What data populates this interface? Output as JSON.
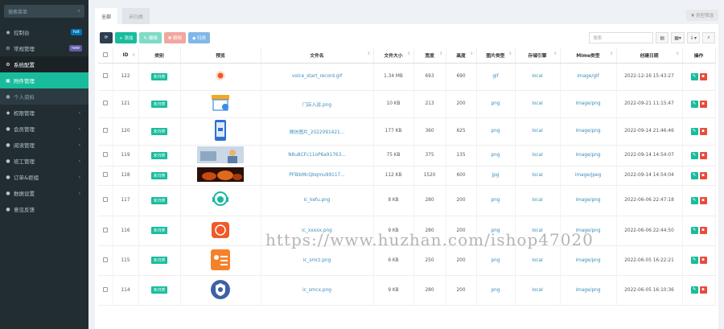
{
  "sidebar": {
    "search_placeholder": "搜索菜单",
    "items": [
      {
        "icon": "dashboard-icon",
        "glyph": "◉",
        "label": "控制台",
        "badge": "hot",
        "badge_color": "#0073b7"
      },
      {
        "icon": "cogs-icon",
        "glyph": "⚙",
        "label": "常规管理",
        "badge": "new",
        "badge_color": "#605ca8"
      },
      {
        "icon": "cog-icon",
        "glyph": "⚙",
        "label": "系统配置",
        "state": "sub"
      },
      {
        "icon": "file-image-icon",
        "glyph": "▣",
        "label": "附件管理",
        "state": "active"
      },
      {
        "icon": "user-icon",
        "glyph": "●",
        "label": "个人资料",
        "state": "dim"
      },
      {
        "icon": "group-icon",
        "glyph": "◆",
        "label": "权限管理",
        "chevron": true
      },
      {
        "icon": "users-icon",
        "glyph": "●",
        "label": "会员管理",
        "chevron": true
      },
      {
        "icon": "list-icon",
        "glyph": "●",
        "label": "阅读管理",
        "chevron": true
      },
      {
        "icon": "staff-icon",
        "glyph": "●",
        "label": "班工管理",
        "chevron": true
      },
      {
        "icon": "order-icon",
        "glyph": "●",
        "label": "订单&拒组",
        "chevron": true
      },
      {
        "icon": "data-icon",
        "glyph": "●",
        "label": "数据设置",
        "chevron": true
      },
      {
        "icon": "feedback-icon",
        "glyph": "●",
        "label": "意见反馈"
      }
    ]
  },
  "tabs": [
    {
      "label": "全部",
      "active": true
    },
    {
      "label": "未归类",
      "active": false
    }
  ],
  "filter_button": "▼ 类型筛选",
  "toolbar": {
    "refresh": "⟳",
    "add": "+ 添加",
    "edit": "✎ 编辑",
    "delete": "✖ 删除",
    "categorize": "◆ 归类"
  },
  "search": {
    "placeholder": "搜索"
  },
  "columns": [
    "",
    "ID",
    "类别",
    "预览",
    "文件名",
    "文件大小",
    "宽度",
    "高度",
    "图片类型",
    "存储引擎",
    "Mime类型",
    "创建日期",
    "操作"
  ],
  "rows": [
    {
      "id": "122",
      "category": "未归类",
      "thumb": "orange-dot",
      "filename": "voice_start_record.gif",
      "size": "1.34 MB",
      "width": "693",
      "height": "690",
      "type": "gif",
      "storage": "local",
      "mime": "image/gif",
      "date": "2022-12-16 15:43:27"
    },
    {
      "id": "121",
      "category": "未归类",
      "thumb": "shop",
      "filename": "门店入驻.png",
      "size": "10 KB",
      "width": "213",
      "height": "200",
      "type": "png",
      "storage": "local",
      "mime": "image/png",
      "date": "2022-09-21 11:15:47"
    },
    {
      "id": "120",
      "category": "未归类",
      "thumb": "phone",
      "filename": "微信图片_2022091421...",
      "size": "177 KB",
      "width": "360",
      "height": "625",
      "type": "png",
      "storage": "local",
      "mime": "image/png",
      "date": "2022-09-14 21:46:46"
    },
    {
      "id": "119",
      "category": "未归类",
      "thumb": "banner",
      "filename": "N8u8CFc11oP6a91763...",
      "size": "75 KB",
      "width": "375",
      "height": "135",
      "type": "png",
      "storage": "local",
      "mime": "image/png",
      "date": "2022-09-14 14:54:07"
    },
    {
      "id": "118",
      "category": "未归类",
      "thumb": "fire",
      "filename": "PFBlbMcQbqmu99117...",
      "size": "112 KB",
      "width": "1520",
      "height": "600",
      "type": "jpg",
      "storage": "local",
      "mime": "image/jpeg",
      "date": "2022-09-14 14:54:04"
    },
    {
      "id": "117",
      "category": "未归类",
      "thumb": "kefu",
      "filename": "ic_kefu.png",
      "size": "8 KB",
      "width": "280",
      "height": "200",
      "type": "png",
      "storage": "local",
      "mime": "image/png",
      "date": "2022-06-06 22:47:18"
    },
    {
      "id": "116",
      "category": "未归类",
      "thumb": "chat",
      "filename": "ic_xxxxx.png",
      "size": "9 KB",
      "width": "280",
      "height": "200",
      "type": "png",
      "storage": "local",
      "mime": "image/png",
      "date": "2022-06-06 22:44:50"
    },
    {
      "id": "115",
      "category": "未归类",
      "thumb": "card",
      "filename": "ic_smrz.png",
      "size": "6 KB",
      "width": "250",
      "height": "200",
      "type": "png",
      "storage": "local",
      "mime": "image/png",
      "date": "2022-06-05 16:22:21"
    },
    {
      "id": "114",
      "category": "未归类",
      "thumb": "shield",
      "filename": "ic_smcx.png",
      "size": "9 KB",
      "width": "280",
      "height": "200",
      "type": "png",
      "storage": "local",
      "mime": "image/png",
      "date": "2022-06-05 16:10:36"
    }
  ],
  "watermark": "https://www.huzhan.com/ishop47020",
  "colors": {
    "accent": "#18bc9c",
    "danger": "#e74c3c",
    "sidebar": "#222d32",
    "link": "#3c8dbc"
  }
}
